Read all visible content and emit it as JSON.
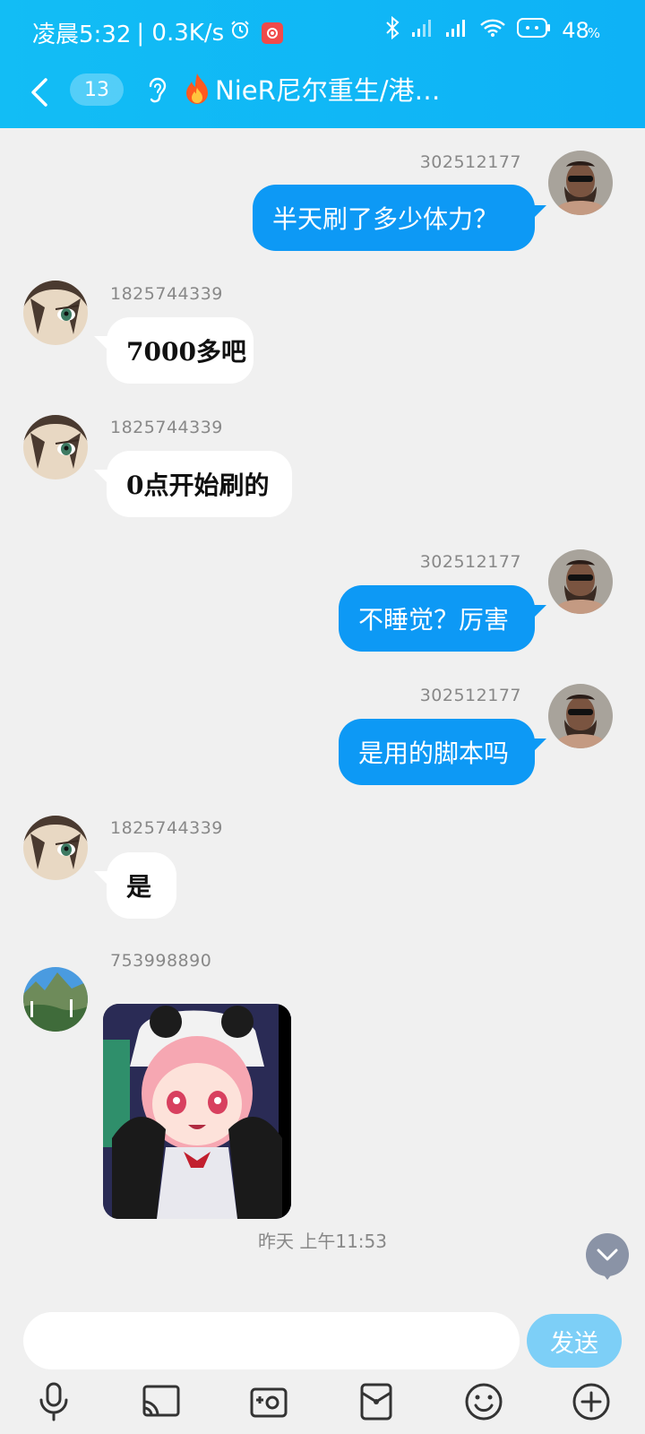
{
  "status_bar": {
    "time": "凌晨5:32",
    "speed": "| 0.3K/s",
    "battery": "48",
    "battery_unit": "%"
  },
  "header": {
    "unread_count": "13",
    "title": "NieR尼尔重生/港…"
  },
  "messages": [
    {
      "sender": "302512177",
      "text": "半天刷了多少体力？",
      "side": "right"
    },
    {
      "sender": "1825744339",
      "text": "7000多吧",
      "side": "left"
    },
    {
      "sender": "1825744339",
      "text": "0点开始刷的",
      "side": "left"
    },
    {
      "sender": "302512177",
      "text": "不睡觉？厉害",
      "side": "right"
    },
    {
      "sender": "302512177",
      "text": "是用的脚本吗",
      "side": "right"
    },
    {
      "sender": "1825744339",
      "text": "是",
      "side": "left"
    },
    {
      "sender": "753998890",
      "text": "",
      "side": "left",
      "type": "image"
    }
  ],
  "timestamp": "昨天 上午11:53",
  "input": {
    "placeholder": "",
    "send_label": "发送"
  },
  "colors": {
    "header": "#12bdf5",
    "my_bubble": "#0d99f5",
    "send_button": "#7dcff7"
  },
  "toolbar_icons": [
    "microphone-icon",
    "screen-cast-icon",
    "camera-icon",
    "red-packet-icon",
    "emoji-icon",
    "plus-icon"
  ]
}
